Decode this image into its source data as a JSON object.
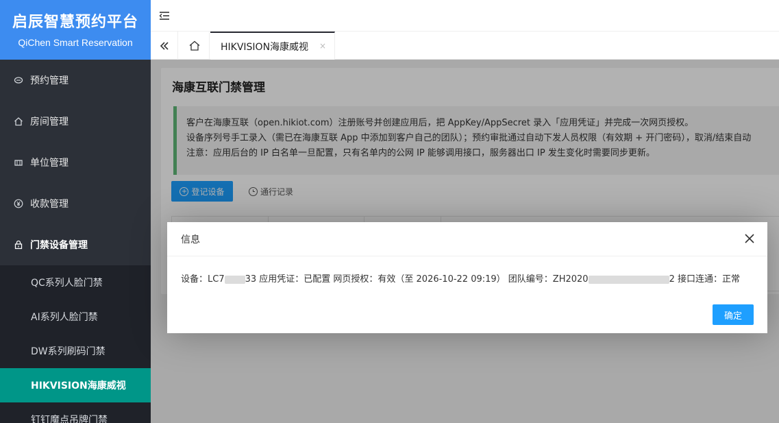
{
  "brand": {
    "title": "启辰智慧预约平台",
    "subtitle": "QiChen Smart Reservation"
  },
  "sidebar": {
    "items": [
      {
        "label": "预约管理",
        "icon": "chat-bubble-icon"
      },
      {
        "label": "房间管理",
        "icon": "home-icon"
      },
      {
        "label": "单位管理",
        "icon": "building-icon"
      },
      {
        "label": "收款管理",
        "icon": "yen-icon"
      },
      {
        "label": "门禁设备管理",
        "icon": "lock-icon"
      }
    ],
    "subitems": [
      {
        "label": "QC系列人脸门禁"
      },
      {
        "label": "AI系列人脸门禁"
      },
      {
        "label": "DW系列刷码门禁"
      },
      {
        "label": "HIKVISION海康威视"
      },
      {
        "label": "钉钉魔点吊牌门禁"
      }
    ]
  },
  "tabs": {
    "current": "HIKVISION海康威视",
    "close": "×"
  },
  "page": {
    "title": "海康互联门禁管理",
    "notice_lines": [
      "客户在海康互联（open.hikiot.com）注册账号并创建应用后，把 AppKey/AppSecret 录入「应用凭证」并完成一次网页授权。",
      "设备序列号手工录入（需已在海康互联 App 中添加到客户自己的团队）；预约审批通过自动下发人员权限（有效期 + 开门密码），取消/结束自动",
      "注意：应用后台的 IP 白名单一旦配置，只有名单内的公网 IP 能够调用接口，服务器出口 IP 发生变化时需要同步更新。"
    ],
    "register_button": "登记设备",
    "log_button": "通行记录"
  },
  "dialog": {
    "title": "信息",
    "body_prefix": "设备：LC7",
    "body_mid": "33 应用凭证：已配置 网页授权：有效（至 2026-10-22 09:19） 团队编号：ZH2020",
    "body_suffix": "2 接口连通：正常",
    "ok_label": "确定"
  },
  "colors": {
    "sidebar_bg": "#2c3038",
    "brand_bg": "#3d8cf0",
    "active": "#009688",
    "primary_button": "#1e9fff"
  }
}
